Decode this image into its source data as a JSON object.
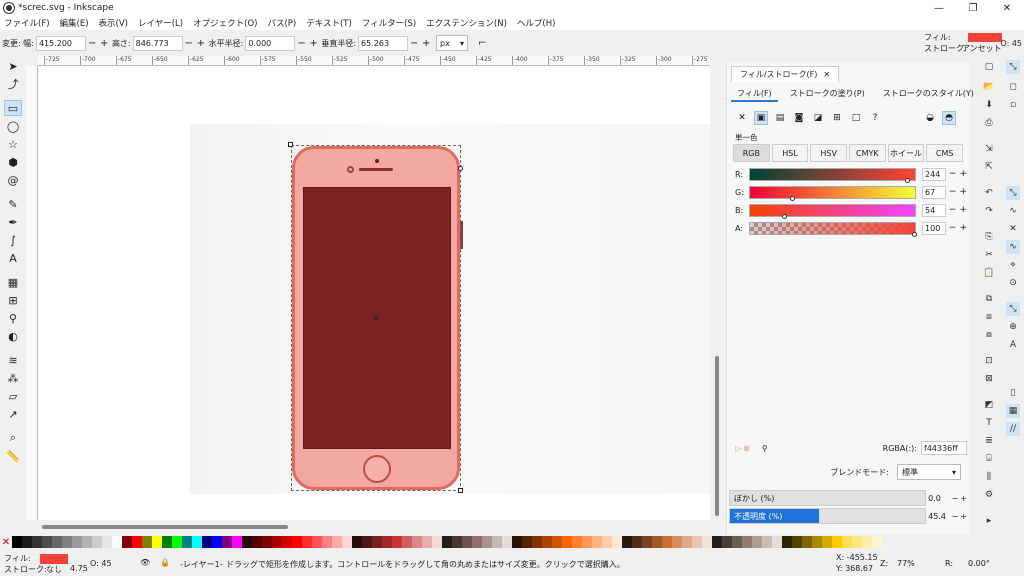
{
  "window": {
    "title": "*screc.svg - Inkscape",
    "controls": [
      "—",
      "❐",
      "✕"
    ]
  },
  "menu": [
    "ファイル(F)",
    "編集(E)",
    "表示(V)",
    "レイヤー(L)",
    "オブジェクト(O)",
    "パス(P)",
    "テキスト(T)",
    "フィルター(S)",
    "エクステンション(N)",
    "ヘルプ(H)"
  ],
  "tool_controls": {
    "w_label": "変更: 幅:",
    "w_value": "415.200",
    "h_label": "高さ:",
    "h_value": "846.773",
    "rx_label": "水平半径:",
    "rx_value": "0.000",
    "ry_label": "垂直半径:",
    "ry_value": "65.263",
    "unit": "px"
  },
  "fs_indicator": {
    "fill_label": "フィル:",
    "stroke_label": "ストローク:",
    "stroke_value": "アンセット",
    "opacity": "O: 45"
  },
  "ruler": {
    "ticks": [
      "-725",
      "-700",
      "-675",
      "-650",
      "-625",
      "-600",
      "-575",
      "-550",
      "-525",
      "-500",
      "-475",
      "-450",
      "-425",
      "-400",
      "-375",
      "-350",
      "-325",
      "-300",
      "-275"
    ]
  },
  "panel": {
    "tab": "フィル/ストローク(F)",
    "subtabs": [
      "フィル(F)",
      "ストロークの塗り(P)",
      "ストロークのスタイル(Y)"
    ],
    "flat_color": "単一色",
    "modes": [
      "RGB",
      "HSL",
      "HSV",
      "CMYK",
      "ホイール",
      "CMS"
    ],
    "channels": [
      {
        "label": "R:",
        "value": "244",
        "level": 0.957
      },
      {
        "label": "G:",
        "value": "67",
        "level": 0.263
      },
      {
        "label": "B:",
        "value": "54",
        "level": 0.212
      },
      {
        "label": "A:",
        "value": "100",
        "level": 1.0
      }
    ],
    "rgba_label": "RGBA(:):",
    "rgba_value": "f44336ff",
    "blend_label": "ブレンドモード:",
    "blend_value": "標準",
    "blur_label": "ぼかし (%)",
    "blur_value": "0.0",
    "blur_level": 0.0,
    "opacity_label": "不透明度 (%)",
    "opacity_value": "45.4",
    "opacity_level": 0.454
  },
  "status": {
    "fill_label": "フィル:",
    "stroke_label": "ストローク:",
    "stroke_value": "なし",
    "stroke_width": "4.75",
    "opacity": "O: 45",
    "layer": "-レイヤー1-",
    "message": "ドラッグで矩形を作成します。コントロールをドラッグして角の丸めまたはサイズ変更。クリックで選択購入。",
    "x": "X: -455.15",
    "y": "Y: 368.67",
    "zoom_label": "Z:",
    "zoom": "77%",
    "rot_label": "R:",
    "rotation": "0.00°"
  },
  "colors": {
    "accent": "#f44336",
    "selected_tab": "#2b7bd3"
  },
  "palette": [
    "#000000",
    "#1a1a1a",
    "#333333",
    "#4d4d4d",
    "#666666",
    "#808080",
    "#999999",
    "#b3b3b3",
    "#cccccc",
    "#e6e6e6",
    "#ffffff",
    "#800000",
    "#ff0000",
    "#808000",
    "#ffff00",
    "#008000",
    "#00ff00",
    "#008080",
    "#00ffff",
    "#000080",
    "#0000ff",
    "#800080",
    "#ff00ff",
    "#2b0000",
    "#550000",
    "#800000",
    "#aa0000",
    "#d40000",
    "#ff0000",
    "#ff2a2a",
    "#ff5555",
    "#ff8080",
    "#ffaaaa",
    "#ffd5d5",
    "#280b0b",
    "#501616",
    "#782121",
    "#a02c2c",
    "#c83737",
    "#d35f5f",
    "#de8787",
    "#e9afaf",
    "#f4d7d7",
    "#241c1c",
    "#483737",
    "#6c5353",
    "#916f6f",
    "#ac9393",
    "#c8b7b7",
    "#e3dbdb",
    "#2b1100",
    "#552200",
    "#803300",
    "#aa4400",
    "#d45500",
    "#ff6600",
    "#ff7f2a",
    "#ff9955",
    "#ffb380",
    "#ffccaa",
    "#ffe6d5",
    "#28170b",
    "#502d16",
    "#784421",
    "#a05a2c",
    "#c87137",
    "#d38d5f",
    "#deaa87",
    "#e9c6af",
    "#f4e3d7",
    "#241f1c",
    "#483e37",
    "#6c5d53",
    "#917c6f",
    "#ac9d93",
    "#c8beb7",
    "#e3dedb",
    "#2b2200",
    "#554400",
    "#806600",
    "#aa8800",
    "#d4aa00",
    "#ffcc00",
    "#ffdd55",
    "#ffe680",
    "#ffeeaa",
    "#fff6d5"
  ]
}
